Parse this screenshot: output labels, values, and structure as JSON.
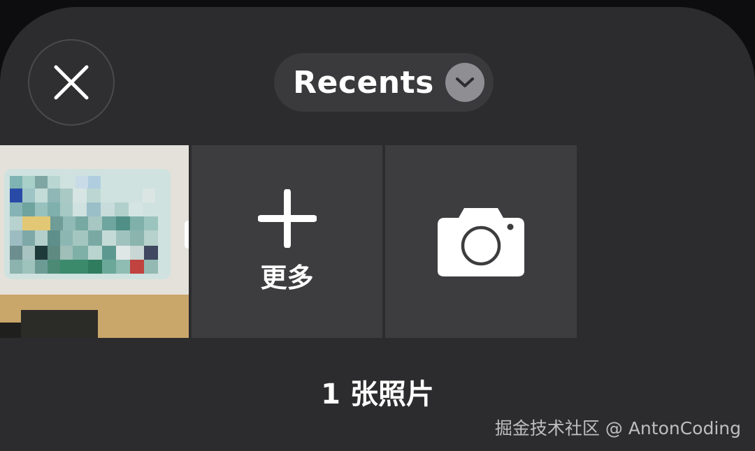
{
  "header": {
    "album_title": "Recents"
  },
  "grid": {
    "more_label": "更多"
  },
  "footer": {
    "photo_count_label": "1 张照片"
  },
  "watermark": "掘金技术社区 @ AntonCoding",
  "icons": {
    "close": "close-icon",
    "chevron": "chevron-down-icon",
    "add": "plus-icon",
    "camera": "camera-icon"
  },
  "colors": {
    "sheet_background": "#2c2c2e",
    "tile_background": "#3d3d3f",
    "pill_background": "#3a3a3c",
    "chevron_circle": "#8e8e93",
    "text": "#ffffff"
  }
}
